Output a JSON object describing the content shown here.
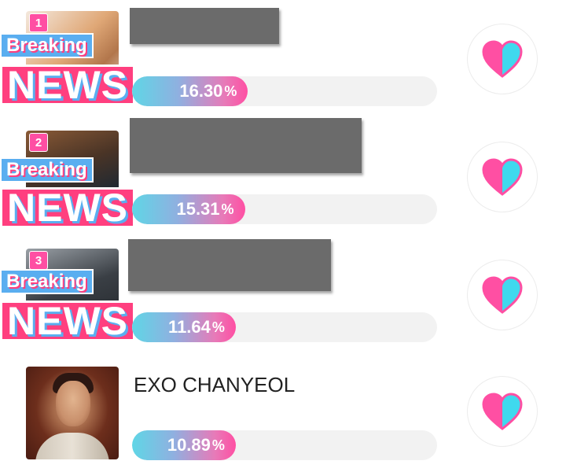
{
  "ranking": {
    "items": [
      {
        "rank": "1",
        "breaking_label": "Breaking",
        "news_label": "NEWS",
        "artist": "",
        "percent": "16.30",
        "percent_value": 16.3,
        "percent_sign": "%",
        "fill_fraction": 0.38
      },
      {
        "rank": "2",
        "breaking_label": "Breaking",
        "news_label": "NEWS",
        "artist": "",
        "percent": "15.31",
        "percent_value": 15.31,
        "percent_sign": "%",
        "fill_fraction": 0.37
      },
      {
        "rank": "3",
        "breaking_label": "Breaking",
        "news_label": "NEWS",
        "artist": "",
        "percent": "11.64",
        "percent_value": 11.64,
        "percent_sign": "%",
        "fill_fraction": 0.34
      },
      {
        "rank": "",
        "breaking_label": "",
        "news_label": "",
        "artist": "EXO CHANYEOL",
        "percent": "10.89",
        "percent_value": 10.89,
        "percent_sign": "%",
        "fill_fraction": 0.34
      }
    ]
  },
  "icons": {
    "vote": "heart-icon"
  },
  "colors": {
    "accent_pink": "#ff4fa3",
    "accent_cyan": "#5fd6e6",
    "breaking_blue": "#5aaef0",
    "news_pink": "#ff3f7f",
    "redaction_gray": "#6b6b6b"
  }
}
